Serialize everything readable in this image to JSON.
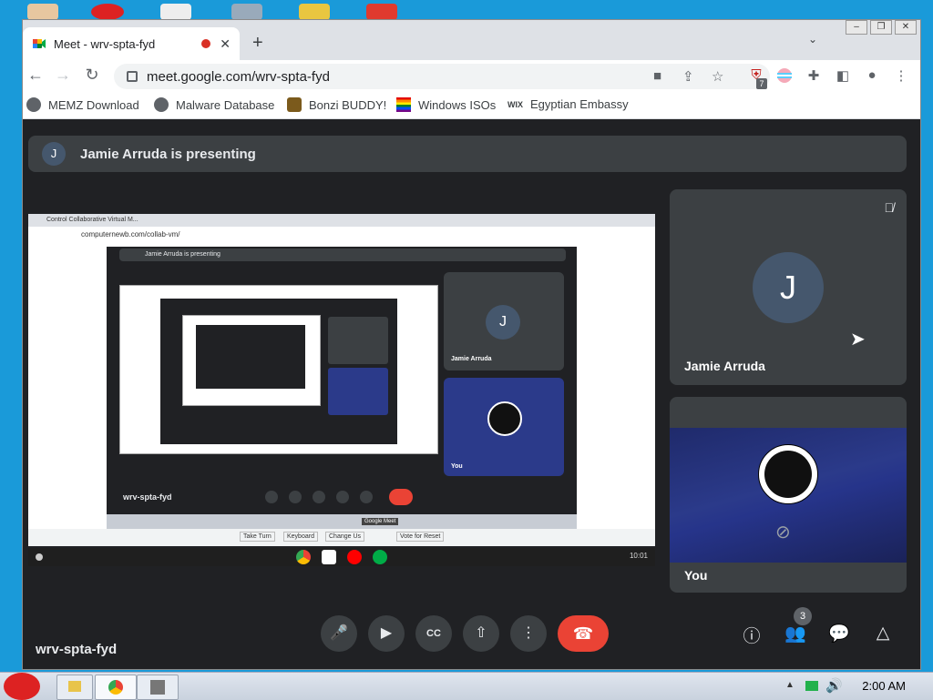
{
  "browser": {
    "tab_title": "Meet - wrv-spta-fyd",
    "new_tab_symbol": "+",
    "url": "meet.google.com/wrv-spta-fyd",
    "extension_badge": "7"
  },
  "bookmarks": [
    {
      "label": "MEMZ Download"
    },
    {
      "label": "Malware Database"
    },
    {
      "label": "Bonzi BUDDY!"
    },
    {
      "label": "Windows ISOs"
    },
    {
      "label": "Egyptian Embassy"
    }
  ],
  "meet": {
    "presenter_initial": "J",
    "presenting_text": "Jamie Arruda is presenting",
    "meeting_code": "wrv-spta-fyd",
    "people_count": "3",
    "participants": [
      {
        "name": "Jamie Arruda",
        "initial": "J",
        "muted": true
      },
      {
        "name": "You",
        "camera_off": true
      }
    ]
  },
  "shared_screen": {
    "tab_title": "Control Collaborative Virtual M...",
    "url": "computernewb.com/collab-vm/",
    "presenting_text": "Jamie Arruda is presenting",
    "presenter_name": "Jamie Arruda",
    "you_label": "You",
    "meeting_code": "wrv-spta-fyd",
    "bottom_buttons": [
      "Take Turn",
      "Keyboard",
      "Change Us",
      "Vote for Reset"
    ],
    "tooltip": "Google Meet",
    "clock": "10:01"
  },
  "taskbar": {
    "clock": "2:00 AM"
  },
  "colors": {
    "meet_bg": "#202124",
    "tile_bg": "#3c4043",
    "end_call": "#ea4335",
    "avatar": "#45576d",
    "desktop": "#1a9ad9"
  }
}
